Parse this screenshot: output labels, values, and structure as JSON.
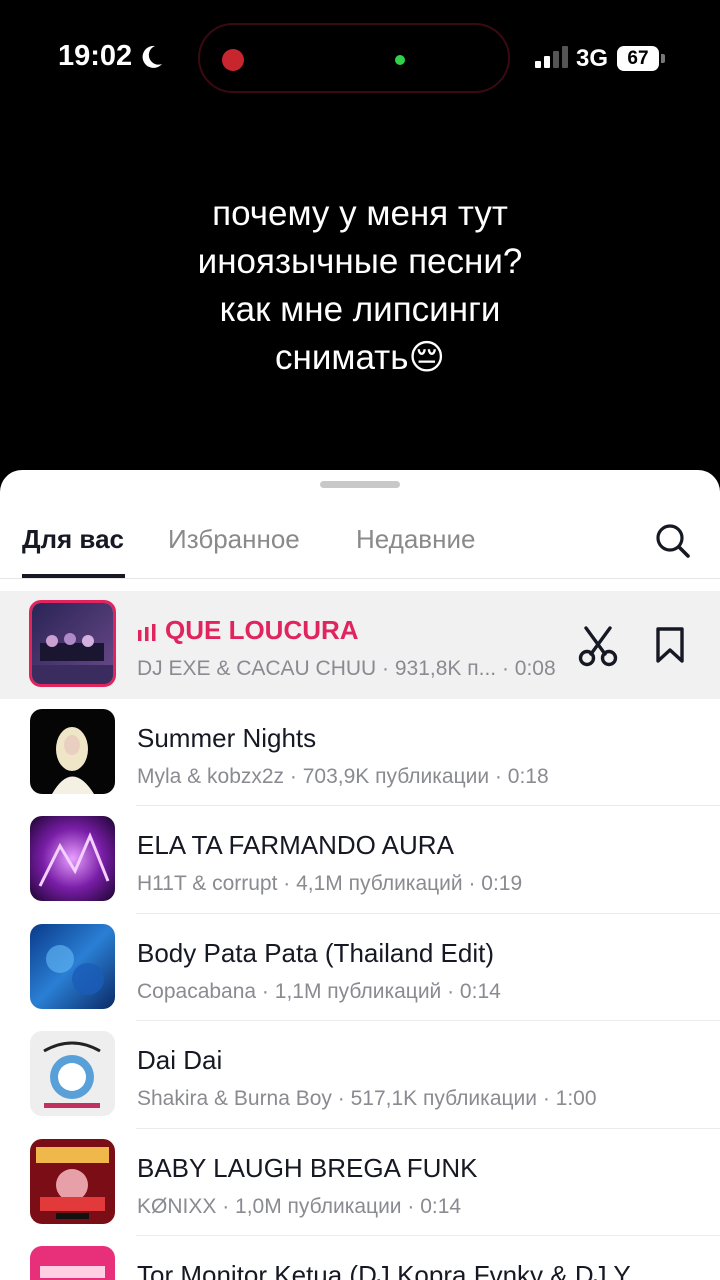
{
  "status": {
    "time": "19:02",
    "network": "3G",
    "battery": "67"
  },
  "caption": {
    "lines": [
      "почему у меня тут",
      "иноязычные песни?",
      "как мне липсинги",
      "снимать😔"
    ]
  },
  "tabs": [
    {
      "label": "Для вас"
    },
    {
      "label": "Избранное"
    },
    {
      "label": "Недавние"
    }
  ],
  "songs": [
    {
      "title": "QUE LOUCURA",
      "subtitle": "DJ EXE & CACAU CHUU · 931,8K п... · 0:08"
    },
    {
      "title": "Summer Nights",
      "subtitle": "Myla & kobzx2z · 703,9K публикации · 0:18"
    },
    {
      "title": "ELA TA FARMANDO AURA",
      "subtitle": "H11T & corrupt · 4,1M публикаций · 0:19"
    },
    {
      "title": "Body Pata Pata (Thailand Edit)",
      "subtitle": "Copacabana · 1,1M публикаций · 0:14"
    },
    {
      "title": "Dai Dai",
      "subtitle": "Shakira & Burna Boy · 517,1K публикации · 1:00"
    },
    {
      "title": "BABY LAUGH BREGA FUNK",
      "subtitle": "KØNIXX · 1,0M публикации · 0:14"
    },
    {
      "title": "Tor Monitor Ketua (DJ Kopra Fvnky & DJ Y...",
      "subtitle": ""
    }
  ],
  "icons": {
    "moon": "moon-icon",
    "search": "search-icon",
    "cut": "scissors-icon",
    "save": "bookmark-icon",
    "playing": "equalizer-icon"
  },
  "colors": {
    "accent": "#e0245e",
    "text": "#161823",
    "secondary": "#8a8b91"
  }
}
